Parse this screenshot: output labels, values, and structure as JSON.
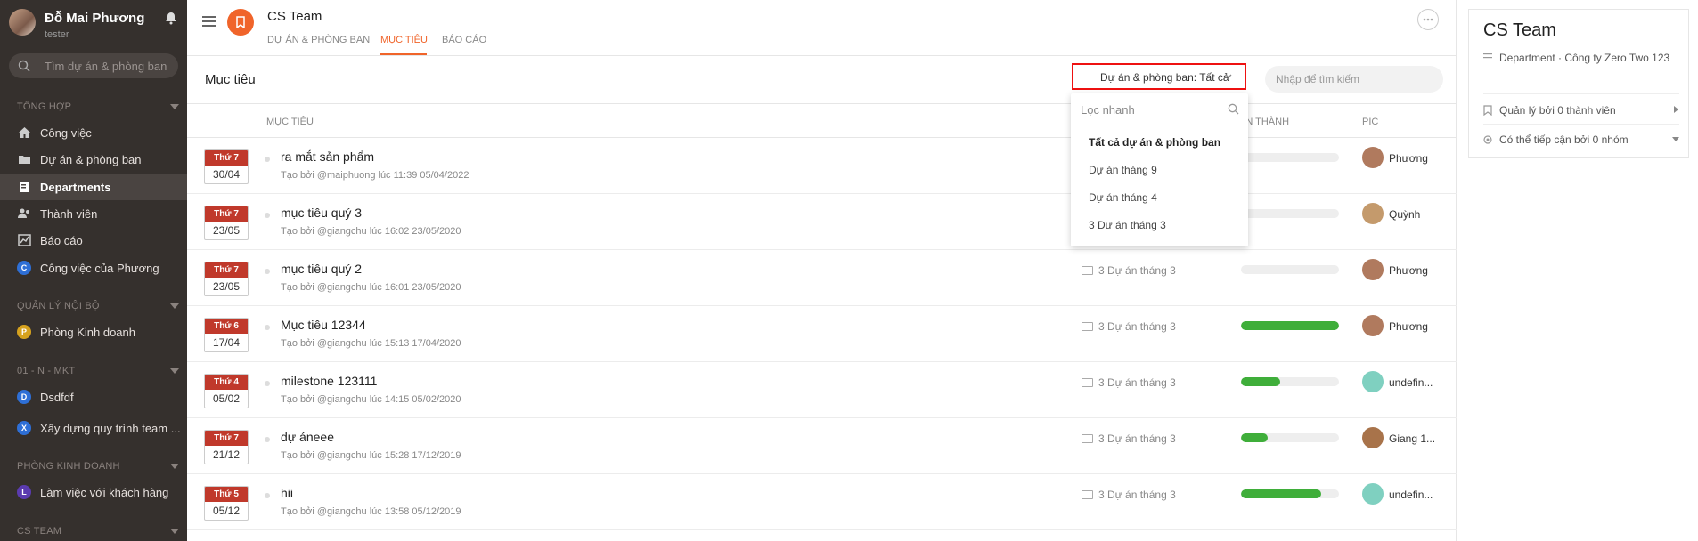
{
  "user": {
    "name": "Đỗ Mai Phương",
    "role": "tester"
  },
  "sidebar": {
    "search_placeholder": "Tìm dự án & phòng ban",
    "sections": [
      {
        "title": "TỔNG HỢP"
      },
      {
        "title": "QUẢN LÝ NỘI BỘ"
      },
      {
        "title": "01 - N - MKT"
      },
      {
        "title": "PHÒNG KINH DOANH"
      },
      {
        "title": "CS TEAM"
      }
    ],
    "items": [
      {
        "label": "Công việc"
      },
      {
        "label": "Dự án & phòng ban"
      },
      {
        "label": "Departments"
      },
      {
        "label": "Thành viên"
      },
      {
        "label": "Báo cáo"
      },
      {
        "label": "Công việc của Phương",
        "badge": "C"
      },
      {
        "label": "Phòng Kinh doanh",
        "badge": "P"
      },
      {
        "label": "Dsdfdf",
        "badge": "D"
      },
      {
        "label": "Xây dựng quy trình team ...",
        "badge": "X"
      },
      {
        "label": "Làm việc với khách hàng",
        "badge": "L"
      }
    ]
  },
  "header": {
    "title": "CS Team",
    "tabs": [
      {
        "label": "DỰ ÁN & PHÒNG BAN"
      },
      {
        "label": "MỤC TIÊU"
      },
      {
        "label": "BÁO CÁO"
      }
    ]
  },
  "subbar": {
    "title": "Mục tiêu",
    "filter_label": "Dự án & phòng ban: Tất cả",
    "search_placeholder": "Nhập để tìm kiếm"
  },
  "table": {
    "headers": {
      "goal": "MỤC TIÊU",
      "done": "ÀN THÀNH",
      "pic": "PIC"
    },
    "rows": [
      {
        "dow": "Thứ 7",
        "dm": "30/04",
        "title": "ra mắt sản phẩm",
        "sub": "Tạo bởi @maiphuong lúc 11:39 05/04/2022",
        "project": "",
        "progress": 0,
        "pic": "Phương"
      },
      {
        "dow": "Thứ 7",
        "dm": "23/05",
        "title": "mục tiêu quý 3",
        "sub": "Tạo bởi @giangchu lúc 16:02 23/05/2020",
        "project": "",
        "progress": 0,
        "pic": "Quỳnh"
      },
      {
        "dow": "Thứ 7",
        "dm": "23/05",
        "title": "mục tiêu quý 2",
        "sub": "Tạo bởi @giangchu lúc 16:01 23/05/2020",
        "project": "3 Dự án tháng 3",
        "progress": 0,
        "pic": "Phương"
      },
      {
        "dow": "Thứ 6",
        "dm": "17/04",
        "title": "Mục tiêu 12344",
        "sub": "Tạo bởi @giangchu lúc 15:13 17/04/2020",
        "project": "3 Dự án tháng 3",
        "progress": 1.0,
        "pic": "Phương"
      },
      {
        "dow": "Thứ 4",
        "dm": "05/02",
        "title": "milestone 123111",
        "sub": "Tạo bởi @giangchu lúc 14:15 05/02/2020",
        "project": "3 Dự án tháng 3",
        "progress": 0.4,
        "pic": "undefin..."
      },
      {
        "dow": "Thứ 7",
        "dm": "21/12",
        "title": "dự áneee",
        "sub": "Tạo bởi @giangchu lúc 15:28 17/12/2019",
        "project": "3 Dự án tháng 3",
        "progress": 0.27,
        "pic": "Giang 1..."
      },
      {
        "dow": "Thứ 5",
        "dm": "05/12",
        "title": "hii",
        "sub": "Tạo bởi @giangchu lúc 13:58 05/12/2019",
        "project": "3 Dự án tháng 3",
        "progress": 0.82,
        "pic": "undefin..."
      }
    ]
  },
  "dropdown": {
    "search_placeholder": "Lọc nhanh",
    "options": [
      {
        "label": "Tất cả dự án & phòng ban"
      },
      {
        "label": "Dự án tháng 9"
      },
      {
        "label": "Dự án tháng 4"
      },
      {
        "label": "3 Dự án tháng 3"
      }
    ]
  },
  "panel": {
    "title": "CS Team",
    "type_line": "Department · Công ty Zero Two 123",
    "managed": "Quản lý bởi 0 thành viên",
    "access": "Có thể tiếp cận bởi 0 nhóm"
  },
  "colors": {
    "accent": "#f0642a",
    "sidebar": "#35302d",
    "progress": "#3fae3a",
    "date_header": "#c0392b",
    "highlight": "#e11"
  },
  "icons": [
    "bell-icon",
    "search-icon",
    "home-icon",
    "folder-icon",
    "department-icon",
    "users-icon",
    "report-icon",
    "hamburger-icon",
    "bookmark-icon",
    "more-icon",
    "chevron-down-icon"
  ]
}
